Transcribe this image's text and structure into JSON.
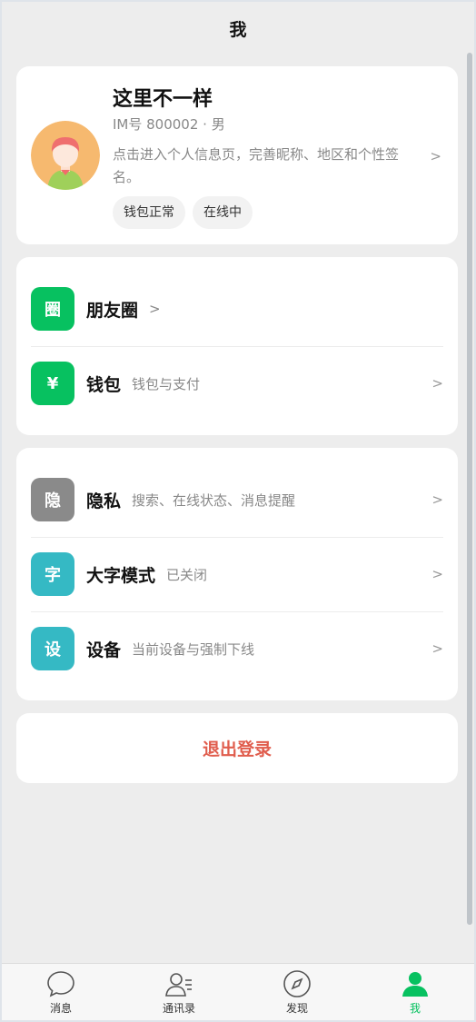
{
  "header": {
    "title": "我"
  },
  "profile": {
    "name": "这里不一样",
    "meta": "IM号 800002 · 男",
    "description": "点击进入个人信息页，完善昵称、地区和个性签名。",
    "tags": [
      "钱包正常",
      "在线中"
    ],
    "arrow": ">"
  },
  "group1": [
    {
      "icon_text": "圈",
      "icon_color": "#07c160",
      "label": "朋友圈",
      "inline": ">"
    },
    {
      "icon_text": "¥",
      "icon_color": "#07c160",
      "label": "钱包",
      "sub": "钱包与支付",
      "arrow": ">"
    }
  ],
  "group2": [
    {
      "icon_text": "隐",
      "icon_color": "#8a8a8a",
      "label": "隐私",
      "sub": "搜索、在线状态、消息提醒",
      "arrow": ">"
    },
    {
      "icon_text": "字",
      "icon_color": "#35b9c4",
      "label": "大字模式",
      "sub": "已关闭",
      "arrow": ">"
    },
    {
      "icon_text": "设",
      "icon_color": "#35b9c4",
      "label": "设备",
      "sub": "当前设备与强制下线",
      "arrow": ">"
    }
  ],
  "logout": {
    "label": "退出登录"
  },
  "tabbar": {
    "tabs": [
      {
        "label": "消息",
        "icon": "chat-bubble-icon"
      },
      {
        "label": "通讯录",
        "icon": "contacts-icon"
      },
      {
        "label": "发现",
        "icon": "compass-icon"
      },
      {
        "label": "我",
        "icon": "person-icon",
        "active": true
      }
    ]
  }
}
